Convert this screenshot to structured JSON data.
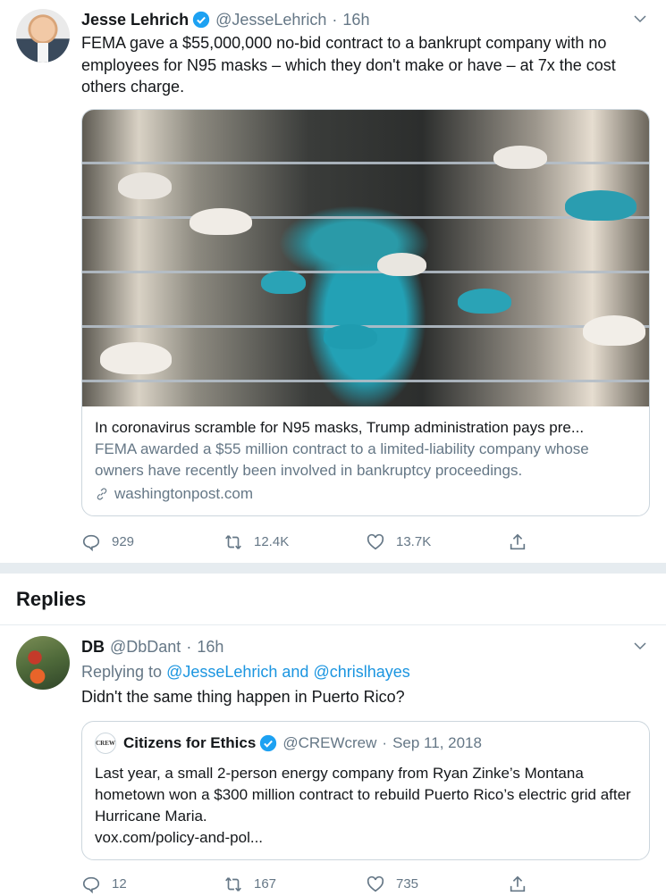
{
  "main_tweet": {
    "name": "Jesse Lehrich",
    "handle": "@JesseLehrich",
    "separator": "·",
    "time": "16h",
    "text": "FEMA gave a $55,000,000 no-bid contract to a bankrupt company with no employees for N95 masks – which they don't make or have – at 7x the cost others charge.",
    "card": {
      "title": "In coronavirus scramble for N95 masks, Trump administration pays pre...",
      "description": "FEMA awarded a $55 million contract to a limited-liability company whose owners have recently been involved in bankruptcy proceedings.",
      "domain": "washingtonpost.com"
    },
    "actions": {
      "replies": "929",
      "retweets": "12.4K",
      "likes": "13.7K"
    }
  },
  "replies_heading": "Replies",
  "reply": {
    "name": "DB",
    "handle": "@DbDant",
    "separator": "·",
    "time": "16h",
    "replying_prefix": "Replying to",
    "replying_to": "@JesseLehrich and @chrislhayes",
    "text": "Didn't the same thing happen in Puerto Rico?",
    "quote": {
      "logo_text": "CREW",
      "name": "Citizens for Ethics",
      "handle": "@CREWcrew",
      "separator": "·",
      "date": "Sep 11, 2018",
      "text": "Last year, a small 2-person energy company from Ryan Zinke’s Montana hometown won a $300 million contract to rebuild Puerto Rico’s electric grid after Hurricane Maria.",
      "link": "vox.com/policy-and-pol..."
    },
    "actions": {
      "replies": "12",
      "retweets": "167",
      "likes": "735"
    }
  },
  "colors": {
    "accent": "#1b95e0",
    "muted": "#657786",
    "border": "#ccd6dd",
    "divider": "#e6ecf0"
  }
}
